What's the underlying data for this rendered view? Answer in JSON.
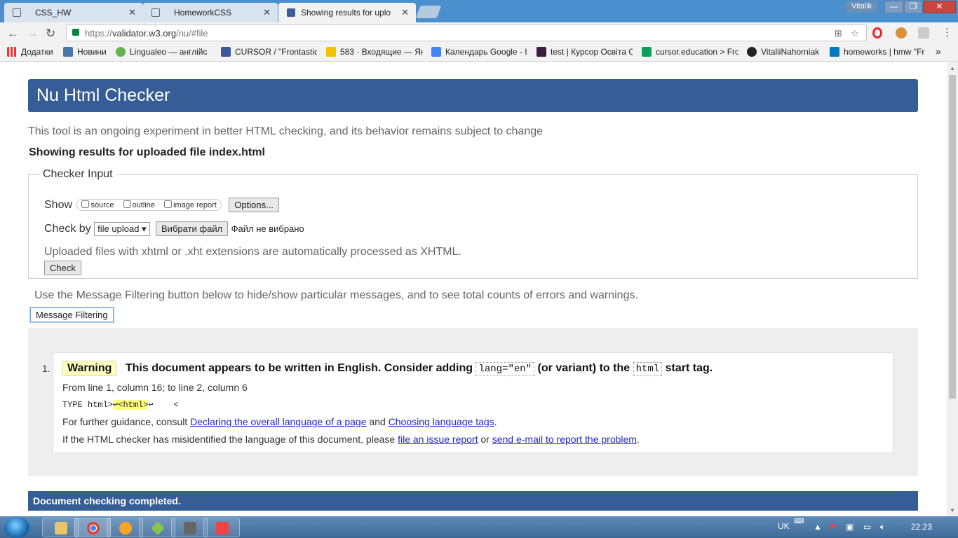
{
  "browser": {
    "tabs": [
      {
        "title": "CSS_HW",
        "close": "✕"
      },
      {
        "title": "HomeworkCSS",
        "close": "✕"
      },
      {
        "title": "Showing results for uplo",
        "close": "✕"
      }
    ],
    "user": "Vitalik",
    "url_scheme": "https://",
    "url_host": "validator.w3.org",
    "url_path": "/nu/#file",
    "bookmarks": [
      {
        "label": "Додатки",
        "icon_color": "#d44"
      },
      {
        "label": "Новини",
        "icon_color": "#4a76a8"
      },
      {
        "label": "Lingualeo — англійс",
        "icon_color": "#6ab04c"
      },
      {
        "label": "CURSOR / \"Frontastic",
        "icon_color": "#3b5998"
      },
      {
        "label": "583 · Входящие — Ян",
        "icon_color": "#f2c200"
      },
      {
        "label": "Календарь Google - I",
        "icon_color": "#4285f4"
      },
      {
        "label": "test | Курсор Освіта С",
        "icon_color": "#3c1e3e"
      },
      {
        "label": "cursor.education > Fro",
        "icon_color": "#0f9d58"
      },
      {
        "label": "VitaliiNahorniak",
        "icon_color": "#222"
      },
      {
        "label": "homeworks | hmw \"Fr",
        "icon_color": "#0079bf"
      }
    ],
    "bookmarks_overflow": "»"
  },
  "page": {
    "banner_title": "Nu Html Checker",
    "subtitle": "This tool is an ongoing experiment in better HTML checking, and its behavior remains subject to change",
    "showing": "Showing results for uploaded file index.html",
    "checker_input": {
      "legend": "Checker Input",
      "show_label": "Show",
      "options": [
        "source",
        "outline",
        "image report"
      ],
      "options_button": "Options...",
      "check_by_label": "Check by",
      "check_by_value": "file upload ▾",
      "choose_file_button": "Вибрати файл",
      "no_file": "Файл не вибрано",
      "note": "Uploaded files with xhtml or .xht extensions are automatically processed as XHTML.",
      "check_button": "Check"
    },
    "filtering_text": "Use the Message Filtering button below to hide/show particular messages, and to see total counts of errors and warnings.",
    "filtering_button": "Message Filtering",
    "messages": [
      {
        "number": "1.",
        "type": "Warning",
        "text_1": "This document appears to be written in English. Consider adding",
        "code_1": "lang=\"en\"",
        "text_2": "(or variant) to the",
        "code_2": "html",
        "text_3": "start tag.",
        "location": "From line 1, column 16; to line 2, column 6",
        "extract_before": "TYPE html>",
        "extract_highlight": "↩<html>",
        "extract_after": "↩    <",
        "guidance_prefix": "For further guidance, consult",
        "link_1": "Declaring the overall language of a page",
        "guidance_and": "and",
        "link_2": "Choosing language tags",
        "guidance_end": ".",
        "misid_prefix": "If the HTML checker has misidentified the language of this document, please",
        "link_3": "file an issue report",
        "misid_or": "or",
        "link_4": "send e-mail to report the problem",
        "misid_end": "."
      }
    ],
    "completed": "Document checking completed."
  },
  "taskbar": {
    "lang": "UK",
    "clock": "22:23"
  }
}
